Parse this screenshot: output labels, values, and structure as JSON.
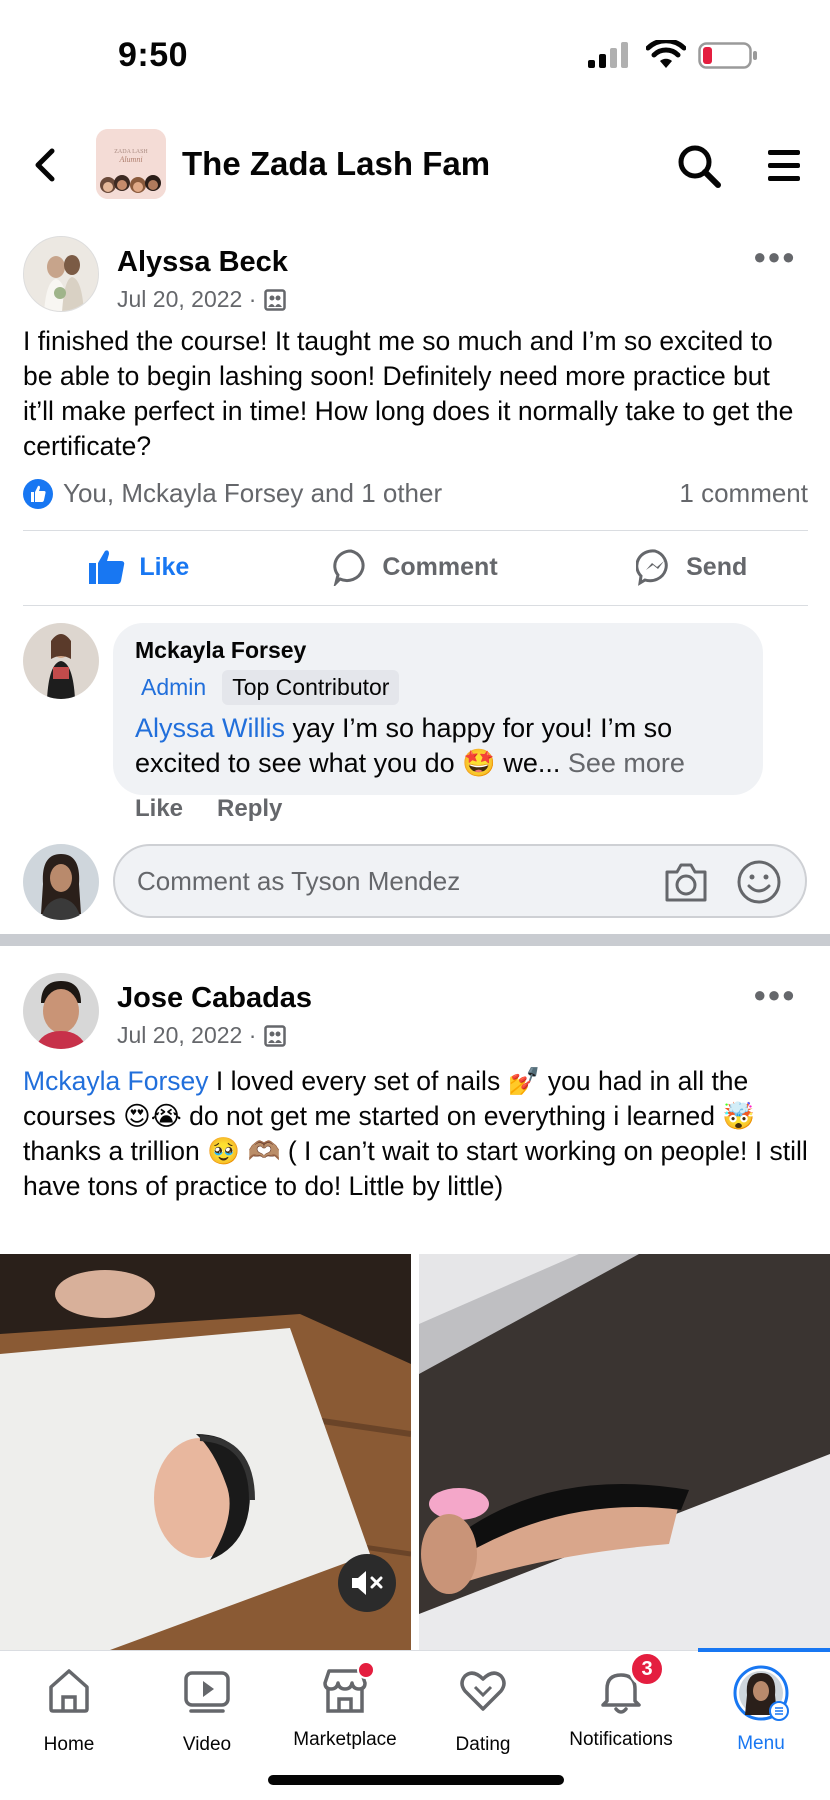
{
  "status_bar": {
    "time": "9:50"
  },
  "header": {
    "group_name": "The Zada Lash Fam"
  },
  "post1": {
    "author": "Alyssa Beck",
    "date": "Jul 20, 2022 ·",
    "text": "I finished the course! It taught me so much and I’m so excited to be able to begin lashing soon! Definitely need more practice but it’ll make perfect in time! How long does it normally take to get the certificate?",
    "reactions": "You, Mckayla Forsey and 1 other",
    "comment_count": "1 comment",
    "actions": {
      "like": "Like",
      "comment": "Comment",
      "send": "Send"
    },
    "comment": {
      "author": "Mckayla Forsey",
      "badge_admin": "Admin",
      "badge_top": "Top Contributor",
      "mention": "Alyssa Willis",
      "text": " yay I’m so happy for you! I’m so excited to see what you do 🤩 we...",
      "see_more": " See more",
      "like": "Like",
      "reply": "Reply"
    },
    "comment_input_placeholder": "Comment as Tyson Mendez"
  },
  "post2": {
    "author": "Jose Cabadas",
    "date": "Jul 20, 2022 ·",
    "mention": "Mckayla Forsey",
    "text": " I loved every set of nails 💅 you had in all the courses 😍😭 do not get me started on everything i learned 🤯 thanks a trillion 🥹 🫶🏽 ( I can’t wait to start working on people! I still have tons of practice to do! Little by little)"
  },
  "tabs": {
    "home": "Home",
    "video": "Video",
    "marketplace": "Marketplace",
    "dating": "Dating",
    "notifications": "Notifications",
    "notifications_count": "3",
    "menu": "Menu"
  },
  "colors": {
    "accent": "#1877f2",
    "badge": "#e41e3f",
    "secondary_text": "#65676b"
  }
}
